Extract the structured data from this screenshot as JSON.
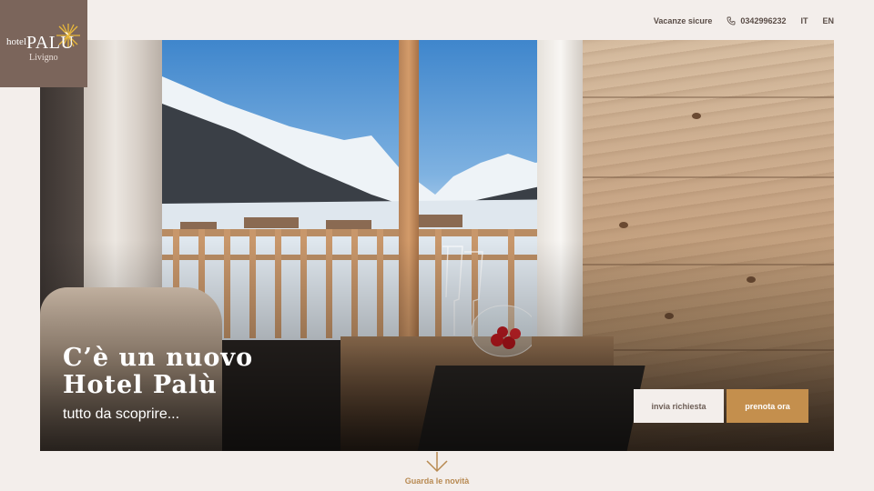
{
  "brand": {
    "word_hotel": "hotel",
    "word_name": "PALÙ",
    "word_place": "Livigno",
    "accent_color": "#e8b83b",
    "logo_bg": "#7b655b"
  },
  "topnav": {
    "safe_holidays": "Vacanze sicure",
    "phone_icon": "phone-icon",
    "phone": "0342996232",
    "lang_it": "IT",
    "lang_en": "EN"
  },
  "hero": {
    "title_line1": "C’è un nuovo",
    "title_line2": "Hotel Palù",
    "subtitle": "tutto da scoprire...",
    "request_button": "invia richiesta",
    "book_button": "prenota ora",
    "book_color": "#c48f4d"
  },
  "scroll_cta": {
    "icon": "arrow-down-icon",
    "label": "Guarda le novità"
  }
}
